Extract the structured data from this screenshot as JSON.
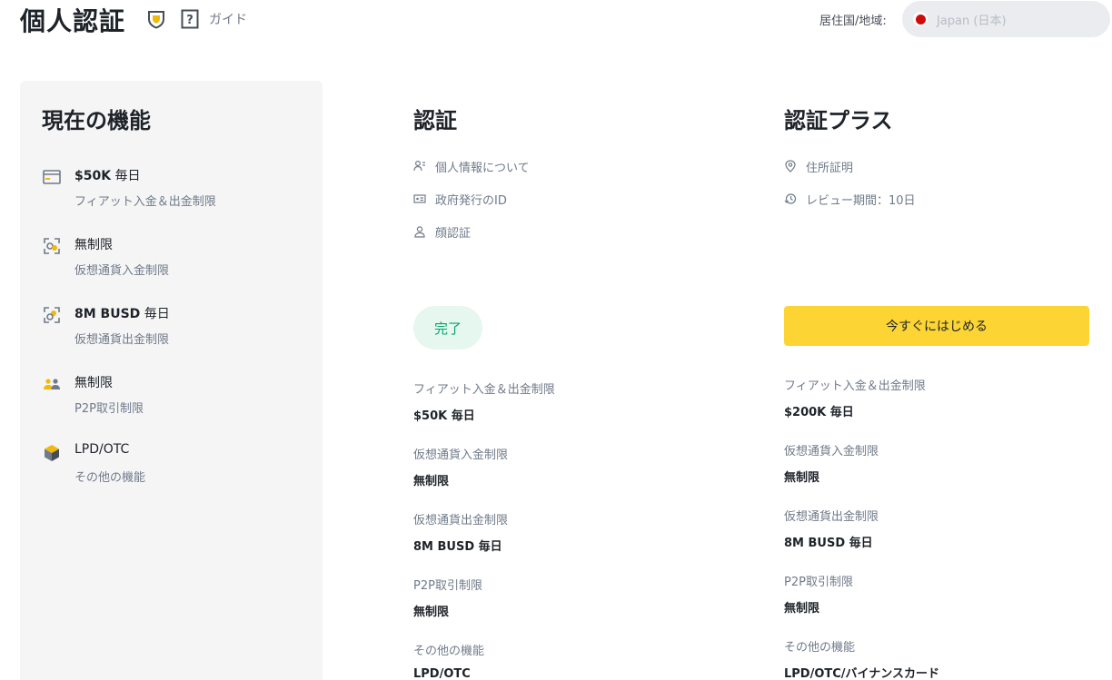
{
  "header": {
    "title": "個人認証",
    "guide_label": "ガイド",
    "region_label": "居住国/地域:",
    "region_value": "Japan (日本)"
  },
  "current": {
    "title": "現在の機能",
    "features": [
      {
        "main_bold": "$50K",
        "main_rest": " 毎日",
        "sub": "フィアット入金＆出金制限",
        "icon": "card-icon"
      },
      {
        "main_bold": "",
        "main_rest": "無制限",
        "sub": "仮想通貨入金制限",
        "icon": "crypto-deposit-icon"
      },
      {
        "main_bold": "8M BUSD",
        "main_rest": " 毎日",
        "sub": "仮想通貨出金制限",
        "icon": "crypto-withdraw-icon"
      },
      {
        "main_bold": "",
        "main_rest": "無制限",
        "sub": "P2P取引制限",
        "icon": "p2p-users-icon"
      },
      {
        "main_bold": "",
        "main_rest": "LPD/OTC",
        "sub": "その他の機能",
        "icon": "cube-icon"
      }
    ]
  },
  "verified": {
    "title": "認証",
    "requirements": [
      "個人情報について",
      "政府発行のID",
      "顔認証"
    ],
    "status": "完了",
    "limits": [
      {
        "label": "フィアット入金＆出金制限",
        "value": "$50K 毎日"
      },
      {
        "label": "仮想通貨入金制限",
        "value": "無制限"
      },
      {
        "label": "仮想通貨出金制限",
        "value": "8M BUSD 毎日"
      },
      {
        "label": "P2P取引制限",
        "value": "無制限"
      },
      {
        "label": "その他の機能",
        "value": "LPD/OTC"
      }
    ]
  },
  "plus": {
    "title": "認証プラス",
    "requirements": [
      "住所証明",
      "レビュー期間：10日"
    ],
    "button": "今すぐにはじめる",
    "limits": [
      {
        "label": "フィアット入金＆出金制限",
        "value": "$200K 毎日"
      },
      {
        "label": "仮想通貨入金制限",
        "value": "無制限"
      },
      {
        "label": "仮想通貨出金制限",
        "value": "8M BUSD 毎日"
      },
      {
        "label": "P2P取引制限",
        "value": "無制限"
      },
      {
        "label": "その他の機能",
        "value": "LPD/OTC/バイナンスカード"
      }
    ]
  },
  "colors": {
    "accent": "#fcd535",
    "success": "#03a66d",
    "flag_red": "#cf0a0a"
  }
}
